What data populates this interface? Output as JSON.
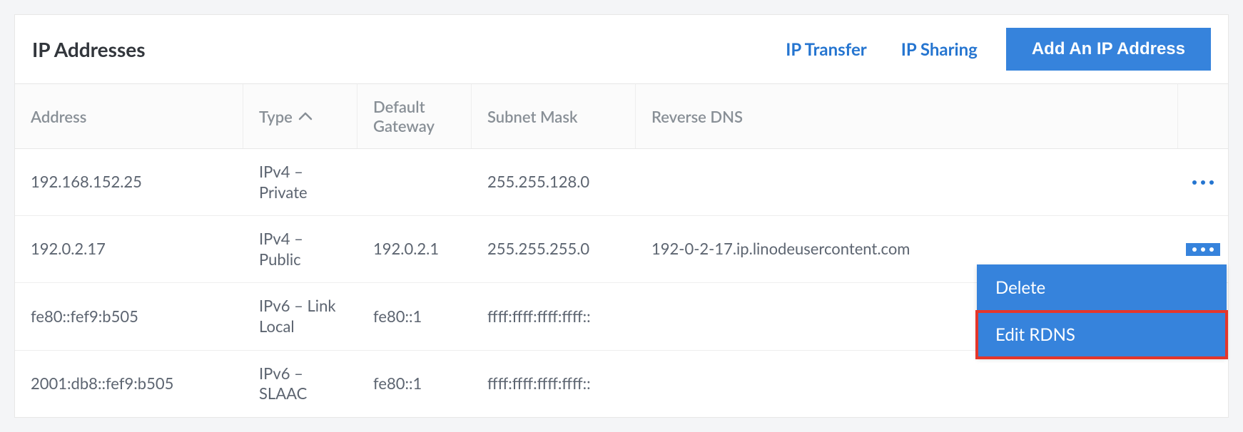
{
  "header": {
    "title": "IP Addresses",
    "transfer_link": "IP Transfer",
    "sharing_link": "IP Sharing",
    "add_button": "Add An IP Address"
  },
  "columns": {
    "address": "Address",
    "type": "Type",
    "gateway": "Default Gateway",
    "subnet": "Subnet Mask",
    "rdns": "Reverse DNS"
  },
  "rows": [
    {
      "address": "192.168.152.25",
      "type": "IPv4 – Private",
      "gateway": "",
      "subnet": "255.255.128.0",
      "rdns": ""
    },
    {
      "address": "192.0.2.17",
      "type": "IPv4 – Public",
      "gateway": "192.0.2.1",
      "subnet": "255.255.255.0",
      "rdns": "192-0-2-17.ip.linodeusercontent.com"
    },
    {
      "address": "fe80::fef9:b505",
      "type": "IPv6 – Link Local",
      "gateway": "fe80::1",
      "subnet": "ffff:ffff:ffff:ffff::",
      "rdns": ""
    },
    {
      "address": "2001:db8::fef9:b505",
      "type": "IPv6 – SLAAC",
      "gateway": "fe80::1",
      "subnet": "ffff:ffff:ffff:ffff::",
      "rdns": ""
    }
  ],
  "dropdown": {
    "delete": "Delete",
    "edit_rdns": "Edit RDNS"
  },
  "sort": {
    "column": "type",
    "direction": "asc"
  },
  "open_menu_row_index": 1
}
